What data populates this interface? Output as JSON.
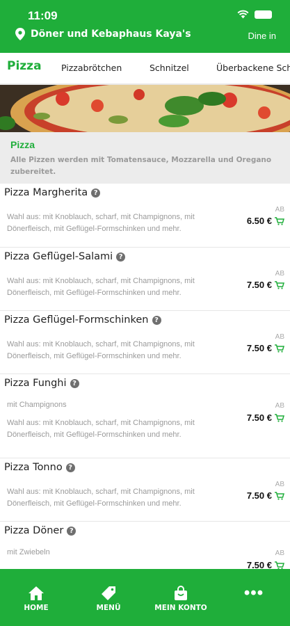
{
  "status": {
    "time": "11:09"
  },
  "header": {
    "store_name": "Döner und Kebaphaus Kaya's",
    "mode": "Dine in"
  },
  "tabs": [
    {
      "label": "Pizza",
      "active": true
    },
    {
      "label": "Pizzabrötchen"
    },
    {
      "label": "Schnitzel"
    },
    {
      "label": "Überbackene Sch"
    }
  ],
  "category": {
    "title": "Pizza",
    "description": "Alle Pizzen werden mit Tomatensauce, Mozzarella und Oregano zubereitet."
  },
  "items": [
    {
      "name": "Pizza Margherita",
      "sub": "",
      "desc": "Wahl aus: mit Knoblauch, scharf, mit Champignons, mit Dönerfleisch, mit Geflügel-Formschinken und mehr.",
      "ab": "AB",
      "price": "6.50 €"
    },
    {
      "name": "Pizza Geflügel-Salami",
      "sub": "",
      "desc": "Wahl aus: mit Knoblauch, scharf, mit Champignons, mit Dönerfleisch, mit Geflügel-Formschinken und mehr.",
      "ab": "AB",
      "price": "7.50 €"
    },
    {
      "name": "Pizza Geflügel-Formschinken",
      "sub": "",
      "desc": "Wahl aus: mit Knoblauch, scharf, mit Champignons, mit Dönerfleisch, mit Geflügel-Formschinken und mehr.",
      "ab": "AB",
      "price": "7.50 €"
    },
    {
      "name": "Pizza Funghi",
      "sub": "mit Champignons",
      "desc": "Wahl aus: mit Knoblauch, scharf, mit Champignons, mit Dönerfleisch, mit Geflügel-Formschinken und mehr.",
      "ab": "AB",
      "price": "7.50 €"
    },
    {
      "name": "Pizza Tonno",
      "sub": "",
      "desc": "Wahl aus: mit Knoblauch, scharf, mit Champignons, mit Dönerfleisch, mit Geflügel-Formschinken und mehr.",
      "ab": "AB",
      "price": "7.50 €"
    },
    {
      "name": "Pizza Döner",
      "sub": "mit Zwiebeln",
      "desc": "",
      "ab": "AB",
      "price": "7.50 €"
    }
  ],
  "bottom_nav": [
    {
      "label": "HOME",
      "icon": "home-icon"
    },
    {
      "label": "MENÜ",
      "icon": "tag-icon"
    },
    {
      "label": "MEIN KONTO",
      "icon": "bag-icon"
    },
    {
      "label": "",
      "icon": "more-icon"
    }
  ],
  "colors": {
    "brand": "#1fae3a",
    "category_bg": "#ececec",
    "muted_text": "#9a9a9a"
  }
}
